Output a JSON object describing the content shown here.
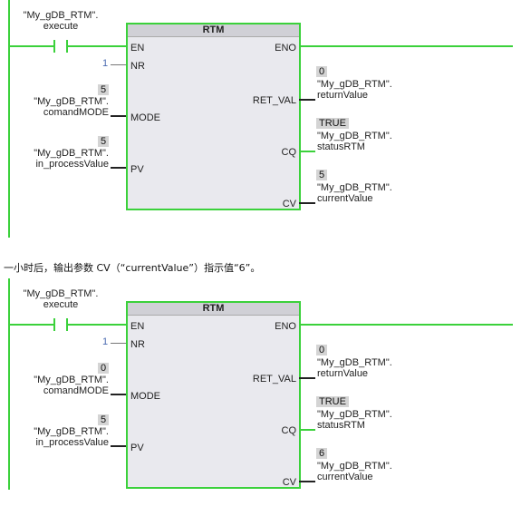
{
  "caption": "一小时后，输出参数 CV（“currentValue”）指示值“6”。",
  "networks": [
    {
      "block_title": "RTM",
      "contact": {
        "line1": "\"My_gDB_RTM\".",
        "line2": "execute"
      },
      "inputs": {
        "en": "EN",
        "nr": {
          "pin": "NR",
          "value": "1"
        },
        "mode": {
          "pin": "MODE",
          "value": "5",
          "line1": "\"My_gDB_RTM\".",
          "line2": "comandMODE"
        },
        "pv": {
          "pin": "PV",
          "value": "5",
          "line1": "\"My_gDB_RTM\".",
          "line2": "in_processValue"
        }
      },
      "outputs": {
        "eno": "ENO",
        "ret_val": {
          "pin": "RET_VAL",
          "value": "0",
          "line1": "\"My_gDB_RTM\".",
          "line2": "returnValue"
        },
        "cq": {
          "pin": "CQ",
          "value": "TRUE",
          "line1": "\"My_gDB_RTM\".",
          "line2": "statusRTM"
        },
        "cv": {
          "pin": "CV",
          "value": "5",
          "line1": "\"My_gDB_RTM\".",
          "line2": "currentValue"
        }
      }
    },
    {
      "block_title": "RTM",
      "contact": {
        "line1": "\"My_gDB_RTM\".",
        "line2": "execute"
      },
      "inputs": {
        "en": "EN",
        "nr": {
          "pin": "NR",
          "value": "1"
        },
        "mode": {
          "pin": "MODE",
          "value": "0",
          "line1": "\"My_gDB_RTM\".",
          "line2": "comandMODE"
        },
        "pv": {
          "pin": "PV",
          "value": "5",
          "line1": "\"My_gDB_RTM\".",
          "line2": "in_processValue"
        }
      },
      "outputs": {
        "eno": "ENO",
        "ret_val": {
          "pin": "RET_VAL",
          "value": "0",
          "line1": "\"My_gDB_RTM\".",
          "line2": "returnValue"
        },
        "cq": {
          "pin": "CQ",
          "value": "TRUE",
          "line1": "\"My_gDB_RTM\".",
          "line2": "statusRTM"
        },
        "cv": {
          "pin": "CV",
          "value": "6",
          "line1": "\"My_gDB_RTM\".",
          "line2": "currentValue"
        }
      }
    }
  ],
  "colors": {
    "power_flow": "#3bd13b",
    "block_bg": "#e9e9ee",
    "value_bg": "#d4d4d4"
  }
}
